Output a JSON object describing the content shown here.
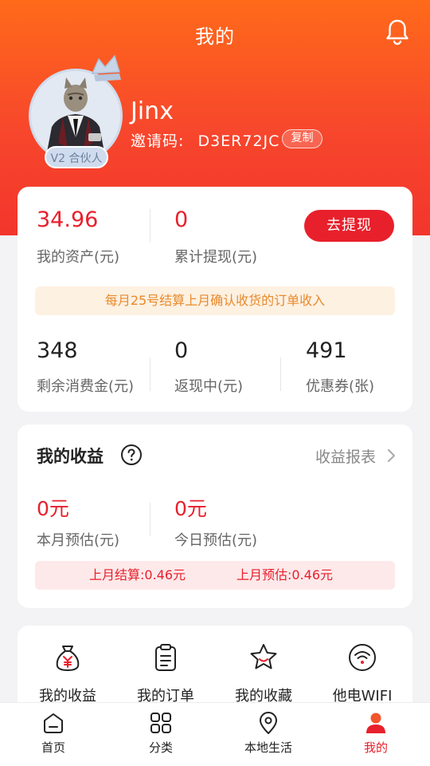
{
  "header": {
    "title": "我的"
  },
  "profile": {
    "username": "Jinx",
    "invite_label": "邀请码:",
    "invite_code": "D3ER72JC",
    "copy_label": "复制",
    "level_badge": "V2 合伙人"
  },
  "assets": {
    "balance_value": "34.96",
    "balance_label": "我的资产(元)",
    "withdrawn_value": "0",
    "withdrawn_label": "累计提现(元)",
    "withdraw_button": "去提现",
    "notice": "每月25号结算上月确认收货的订单收入",
    "stats": [
      {
        "value": "348",
        "label": "剩余消费金(元)"
      },
      {
        "value": "0",
        "label": "返现中(元)"
      },
      {
        "value": "491",
        "label": "优惠券(张)"
      }
    ]
  },
  "earnings": {
    "title": "我的收益",
    "report_link": "收益报表",
    "month_value": "0元",
    "month_label": "本月预估(元)",
    "today_value": "0元",
    "today_label": "今日预估(元)",
    "last_settled": "上月结算:0.46元",
    "last_estimated": "上月预估:0.46元"
  },
  "tools": [
    {
      "label": "我的收益",
      "icon": "money-bag-icon"
    },
    {
      "label": "我的订单",
      "icon": "clipboard-icon"
    },
    {
      "label": "我的收藏",
      "icon": "star-icon"
    },
    {
      "label": "他电WIFI",
      "icon": "wifi-icon"
    }
  ],
  "tabbar": [
    {
      "label": "首页",
      "icon": "home-icon",
      "active": false
    },
    {
      "label": "分类",
      "icon": "grid-icon",
      "active": false
    },
    {
      "label": "本地生活",
      "icon": "location-icon",
      "active": false
    },
    {
      "label": "我的",
      "icon": "user-icon",
      "active": true
    }
  ],
  "colors": {
    "brand_red": "#e8202c",
    "header_orange": "#ff6a1a",
    "notice_orange": "#e98a2b"
  }
}
